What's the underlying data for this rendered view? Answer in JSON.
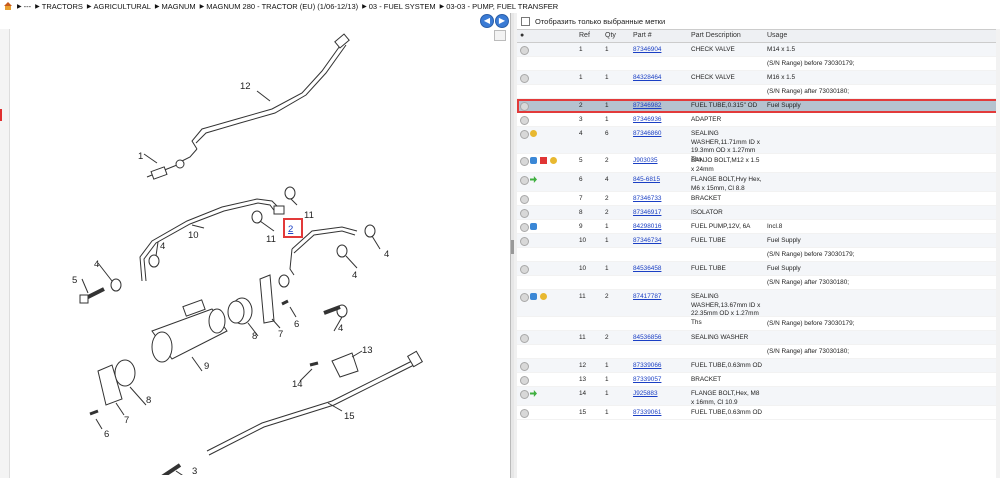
{
  "breadcrumb": [
    "---",
    "TRACTORS",
    "AGRICULTURAL",
    "MAGNUM",
    "MAGNUM 280 - TRACTOR (EU) (1/06-12/13)",
    "03 - FUEL SYSTEM",
    "03-03 - PUMP, FUEL TRANSFER"
  ],
  "nav": {
    "back_icon": "arrow-left-icon",
    "forward_icon": "arrow-right-icon"
  },
  "filter_label": "Отобразить только выбранные метки",
  "columns": {
    "ref": "Ref",
    "qty": "Qty",
    "part": "Part #",
    "desc": "Part Description",
    "usage": "Usage"
  },
  "highlight_color": "#e23a3a",
  "rows": [
    {
      "ref": "1",
      "qty": "1",
      "part": "87346904",
      "desc": "CHECK VALVE",
      "usage": "M14 x 1.5"
    },
    {
      "ref": "",
      "qty": "",
      "part": "",
      "desc": "",
      "usage": "(S/N Range) before 73030179;"
    },
    {
      "ref": "1",
      "qty": "1",
      "part": "84328464",
      "desc": "CHECK VALVE",
      "usage": "M16 x 1.5"
    },
    {
      "ref": "",
      "qty": "",
      "part": "",
      "desc": "",
      "usage": "(S/N Range) after 73030180;"
    },
    {
      "ref": "2",
      "qty": "1",
      "part": "87346982",
      "desc": "FUEL TUBE,0.315\" OD",
      "usage": "Fuel Supply"
    },
    {
      "ref": "3",
      "qty": "1",
      "part": "87346936",
      "desc": "ADAPTER",
      "usage": ""
    },
    {
      "ref": "4",
      "qty": "6",
      "part": "87346860",
      "desc": "SEALING WASHER,11.71mm ID x 19.3mm OD x 1.27mm Ths",
      "usage": ""
    },
    {
      "ref": "5",
      "qty": "2",
      "part": "J903035",
      "desc": "BANJO BOLT,M12 x 1.5 x 24mm",
      "usage": ""
    },
    {
      "ref": "6",
      "qty": "4",
      "part": "845-6815",
      "desc": "FLANGE BOLT,Hvy Hex, M6 x 15mm, Cl 8.8",
      "usage": ""
    },
    {
      "ref": "7",
      "qty": "2",
      "part": "87346733",
      "desc": "BRACKET",
      "usage": ""
    },
    {
      "ref": "8",
      "qty": "2",
      "part": "87346917",
      "desc": "ISOLATOR",
      "usage": ""
    },
    {
      "ref": "9",
      "qty": "1",
      "part": "84298016",
      "desc": "FUEL PUMP,12V, 6A",
      "usage": "Incl.8"
    },
    {
      "ref": "10",
      "qty": "1",
      "part": "87346734",
      "desc": "FUEL TUBE",
      "usage": "Fuel Supply"
    },
    {
      "ref": "",
      "qty": "",
      "part": "",
      "desc": "",
      "usage": "(S/N Range) before 73030179;"
    },
    {
      "ref": "10",
      "qty": "1",
      "part": "84536458",
      "desc": "FUEL TUBE",
      "usage": "Fuel Supply"
    },
    {
      "ref": "",
      "qty": "",
      "part": "",
      "desc": "",
      "usage": "(S/N Range) after 73030180;"
    },
    {
      "ref": "11",
      "qty": "2",
      "part": "87417787",
      "desc": "SEALING WASHER,13.67mm ID x 22.35mm OD x 1.27mm Ths",
      "usage": ""
    },
    {
      "ref": "",
      "qty": "",
      "part": "",
      "desc": "",
      "usage": "(S/N Range) before 73030179;"
    },
    {
      "ref": "11",
      "qty": "2",
      "part": "84536856",
      "desc": "SEALING WASHER",
      "usage": ""
    },
    {
      "ref": "",
      "qty": "",
      "part": "",
      "desc": "",
      "usage": "(S/N Range) after 73030180;"
    },
    {
      "ref": "12",
      "qty": "1",
      "part": "87339066",
      "desc": "FUEL TUBE,0.63mm OD",
      "usage": ""
    },
    {
      "ref": "13",
      "qty": "1",
      "part": "87339057",
      "desc": "BRACKET",
      "usage": ""
    },
    {
      "ref": "14",
      "qty": "1",
      "part": "J925883",
      "desc": "FLANGE BOLT,Hex, M8 x 16mm, Cl 10.9",
      "usage": ""
    },
    {
      "ref": "15",
      "qty": "1",
      "part": "87339061",
      "desc": "FUEL TUBE,0.63mm OD",
      "usage": ""
    }
  ],
  "diagram_labels": [
    "12",
    "1",
    "11",
    "2",
    "11",
    "10",
    "4",
    "4",
    "4",
    "4",
    "5",
    "7",
    "6",
    "4",
    "8",
    "9",
    "7",
    "13",
    "14",
    "8",
    "15",
    "6",
    "3"
  ],
  "selected_callout": "2"
}
